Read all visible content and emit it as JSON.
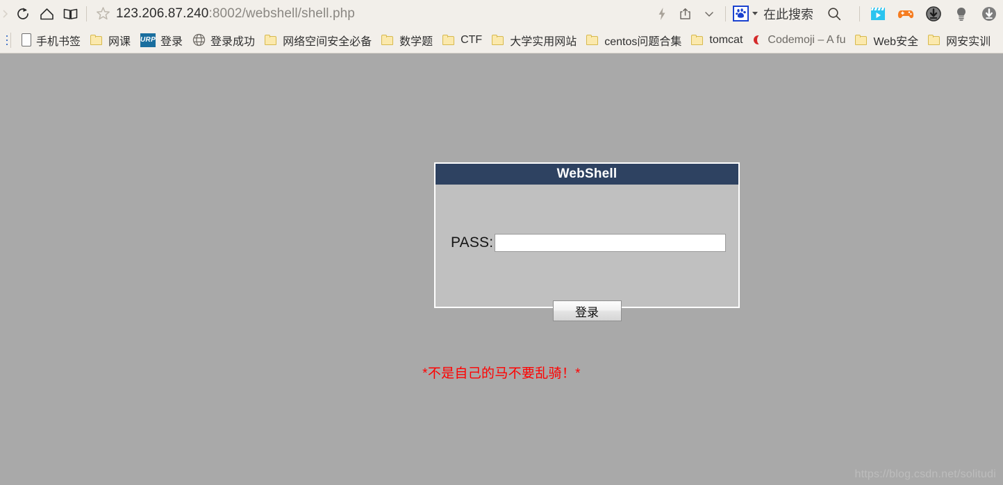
{
  "browser": {
    "toolbar": {
      "forward_icon": "forward-arrow-icon",
      "reload_icon": "reload-icon",
      "home_icon": "home-icon",
      "reading_list_icon": "book-icon",
      "bookmark_star_icon": "star-icon",
      "url_main": "123.206.87.240",
      "url_suffix": ":8002/webshell/shell.php",
      "url_full": "123.206.87.240:8002/webshell/shell.php",
      "lightning_icon": "lightning-icon",
      "share_icon": "share-icon",
      "chevron_icon": "chevron-down-icon",
      "search_engine_icon": "baidu-paw-icon",
      "search_placeholder": "在此搜索",
      "search_icon": "search-icon",
      "extensions": [
        {
          "name": "video-clapperboard-icon",
          "color": "#2bc4ef"
        },
        {
          "name": "game-controller-icon",
          "color": "#f57c20"
        },
        {
          "name": "download-circle-icon",
          "color": "#808080"
        },
        {
          "name": "lightbulb-icon",
          "color": "#6e6e6e"
        },
        {
          "name": "download-arrow-icon",
          "color": "#808080"
        }
      ]
    },
    "bookmarks": [
      {
        "label": "手机书签",
        "icon": "phone-icon"
      },
      {
        "label": "网课",
        "icon": "folder-icon"
      },
      {
        "label": "登录",
        "icon": "urp-icon"
      },
      {
        "label": "登录成功",
        "icon": "globe-icon"
      },
      {
        "label": "网络空间安全必备",
        "icon": "folder-icon"
      },
      {
        "label": "数学题",
        "icon": "folder-icon"
      },
      {
        "label": "CTF",
        "icon": "folder-icon"
      },
      {
        "label": "大学实用网站",
        "icon": "folder-icon"
      },
      {
        "label": "centos问题合集",
        "icon": "folder-icon"
      },
      {
        "label": "tomcat",
        "icon": "folder-icon"
      },
      {
        "label": "Codemoji – A fu",
        "icon": "moon-icon"
      },
      {
        "label": "Web安全",
        "icon": "folder-icon"
      },
      {
        "label": "网安实训",
        "icon": "folder-icon"
      }
    ]
  },
  "page": {
    "panel": {
      "title": "WebShell",
      "pass_label": "PASS:",
      "pass_value": "",
      "pass_placeholder": "",
      "submit_label": "登录"
    },
    "warning": "*不是自己的马不要乱骑！*",
    "watermark": "https://blog.csdn.net/solitudi",
    "colors": {
      "page_background": "#a9a9a9",
      "panel_background": "#c0c0c0",
      "panel_header": "#2e4261",
      "warning_color": "#ff0000",
      "panel_border": "#ffffff"
    }
  }
}
